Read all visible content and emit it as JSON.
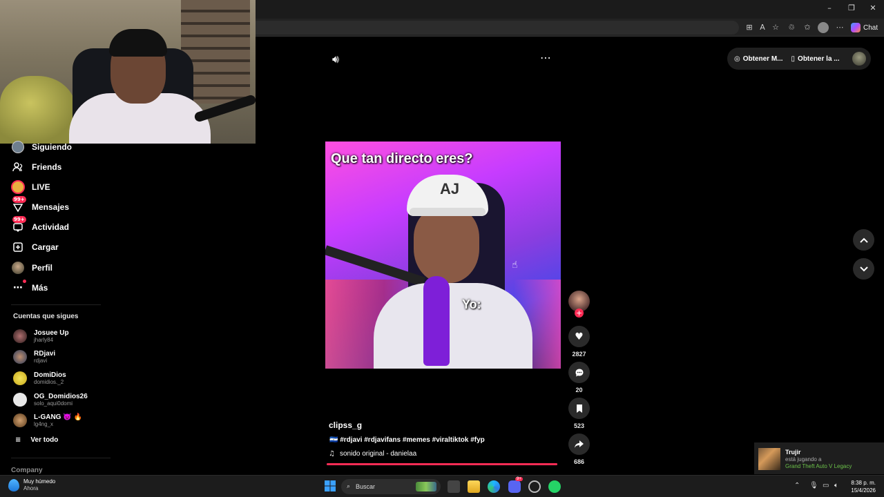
{
  "browser": {
    "chat_label": "Chat",
    "window_controls": {
      "minimize": "–",
      "restore": "❐",
      "close": "✕"
    }
  },
  "page": {
    "obtain_pill_1": "Obtener M...",
    "obtain_pill_2": "Obtener la ..."
  },
  "sidebar": {
    "items": [
      {
        "label": "Siguiendo",
        "icon": "following-avatar-icon"
      },
      {
        "label": "Friends",
        "icon": "friends-icon"
      },
      {
        "label": "LIVE",
        "icon": "live-icon"
      },
      {
        "label": "Mensajes",
        "icon": "messages-icon",
        "badge": "99+"
      },
      {
        "label": "Actividad",
        "icon": "activity-icon",
        "badge": "99+"
      },
      {
        "label": "Cargar",
        "icon": "upload-icon"
      },
      {
        "label": "Perfil",
        "icon": "profile-icon"
      },
      {
        "label": "Más",
        "icon": "more-icon"
      }
    ],
    "following_title": "Cuentas que sigues",
    "accounts": [
      {
        "name": "Josuee Up",
        "user": "jharly84",
        "color": "#5a3a3a"
      },
      {
        "name": "RDjavi",
        "user": "rdjavi",
        "color": "#3a4a6a"
      },
      {
        "name": "DomiDios",
        "user": "domidios._2",
        "color": "#e8d23a"
      },
      {
        "name": "OG_Domidios26",
        "user": "solo_aqui0domi",
        "color": "#e8e8e8"
      },
      {
        "name": "L-GANG 👿 🔥",
        "user": "lg4ng_x",
        "color": "#a0784a"
      }
    ],
    "see_all": "Ver todo",
    "company": "Company"
  },
  "video": {
    "caption_top": "Que tan directo eres?",
    "caption_yo": "Yo:",
    "cap_logo": "AJ",
    "progress": 1.0
  },
  "actions": {
    "likes": "2827",
    "comments": "20",
    "saves": "523",
    "shares": "686"
  },
  "description": {
    "author": "clipss_g",
    "tags": "🇸🇻 #rdjavi #rdjavifans #memes #viraltiktok #fyp",
    "sound": "sonido original - danielaa"
  },
  "notification": {
    "name": "Trujir",
    "subtitle": "está jugando a",
    "game": "Grand Theft Auto V Legacy"
  },
  "taskbar": {
    "weather_title": "Muy húmedo",
    "weather_sub": "Ahora",
    "search_placeholder": "Buscar",
    "time": "8:38 p. m.",
    "date": "15/4/2026",
    "discord_badge": "9+"
  },
  "colors": {
    "accent": "#fe2c55",
    "background": "#000000",
    "game_green": "#6cc24a"
  }
}
